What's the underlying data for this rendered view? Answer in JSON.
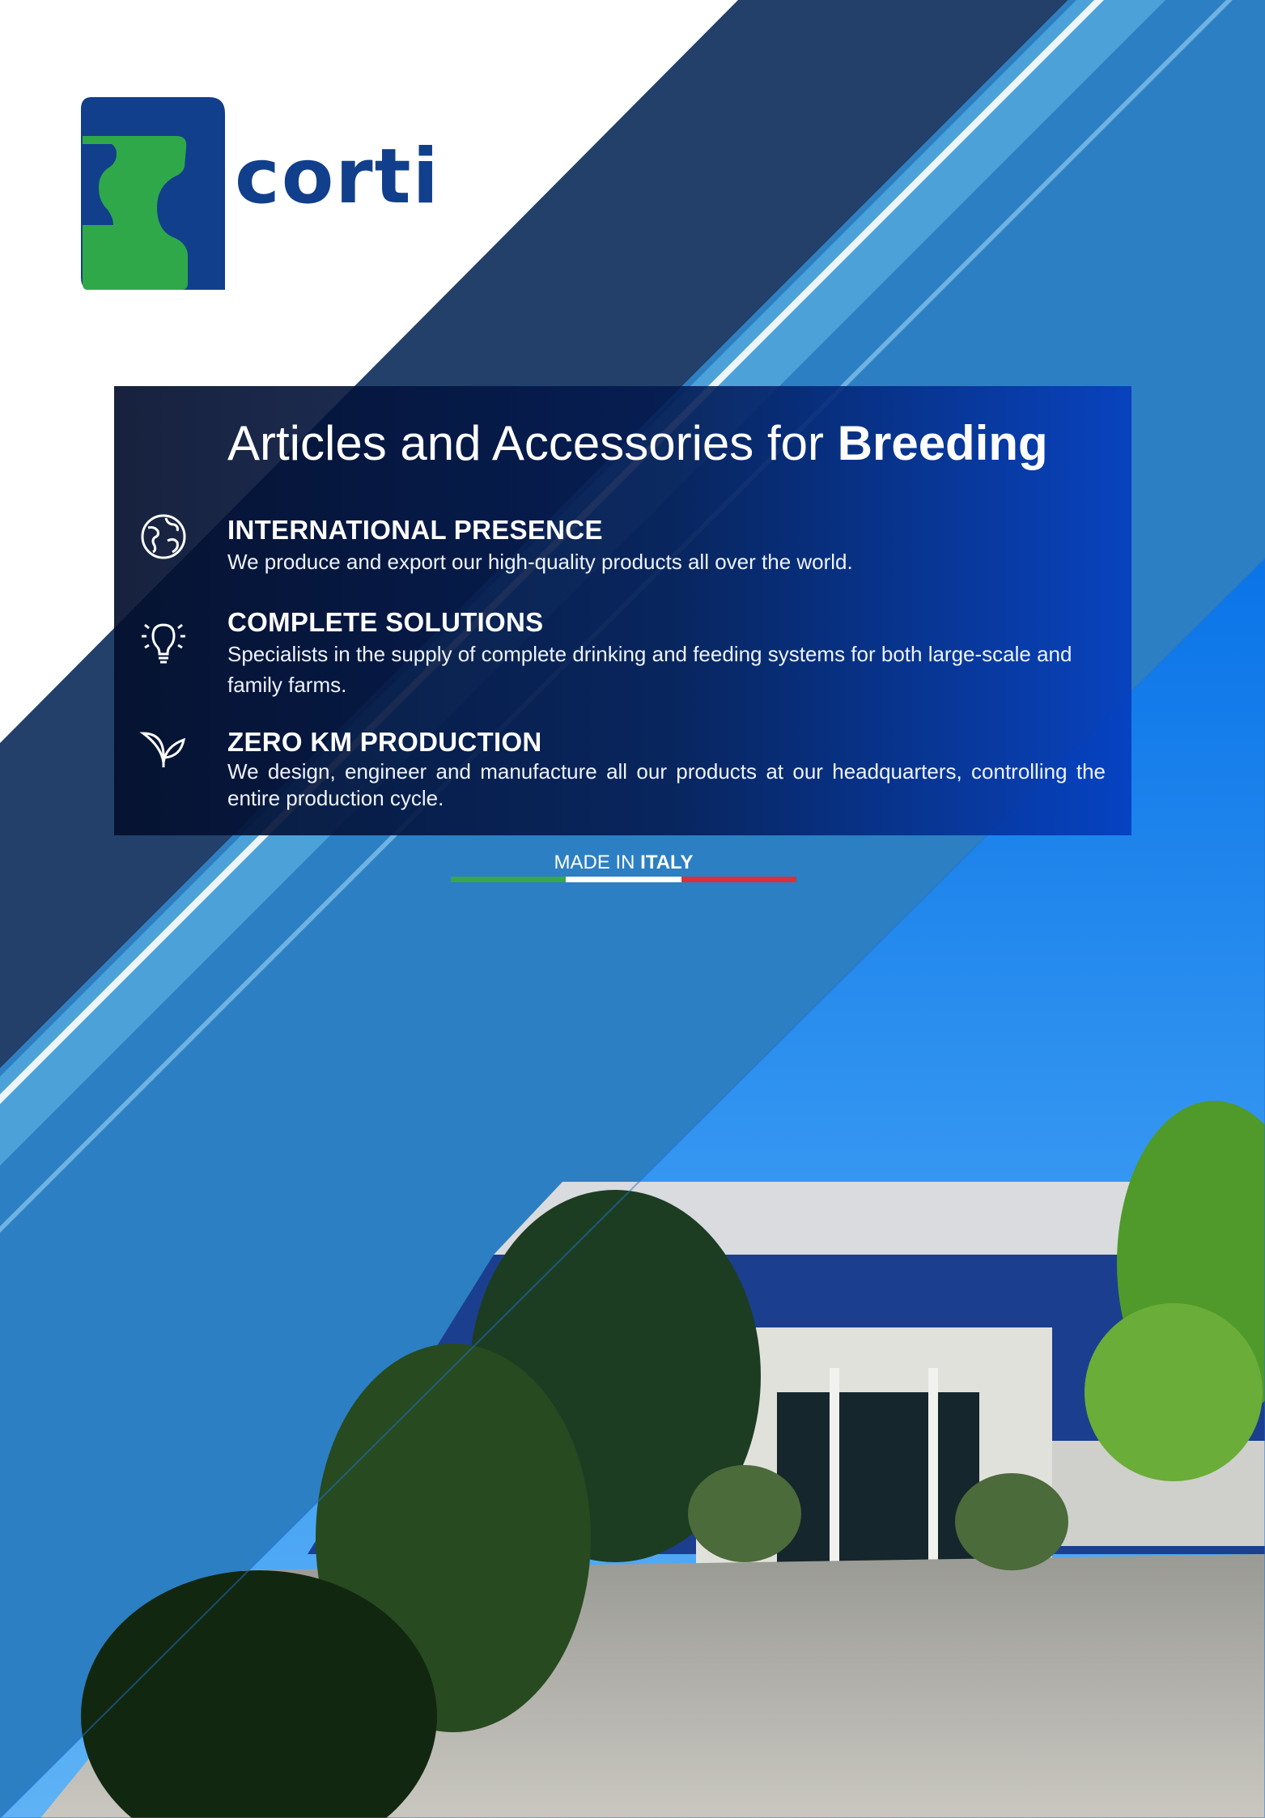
{
  "brand": {
    "name": "corti",
    "green": "#2fa84a",
    "blue": "#113f8c"
  },
  "title": {
    "regular": "Articles and Accessories for ",
    "bold": "Breeding"
  },
  "features": [
    {
      "icon": "globe-icon",
      "title": "INTERNATIONAL PRESENCE",
      "text": "We produce and export our high-quality products all over the world."
    },
    {
      "icon": "lightbulb-icon",
      "title": "COMPLETE SOLUTIONS",
      "text": "Specialists in the supply of complete drinking and feeding systems for both large-scale and family farms."
    },
    {
      "icon": "leaf-icon",
      "title": "ZERO KM PRODUCTION",
      "text": "We design, engineer and manufacture all our products at our headquarters, controlling the entire production cycle."
    }
  ],
  "made_in": {
    "regular": "MADE IN ",
    "bold": "ITALY"
  },
  "flag_colors": [
    "#3aa64a",
    "#ffffff",
    "#d8303c"
  ]
}
